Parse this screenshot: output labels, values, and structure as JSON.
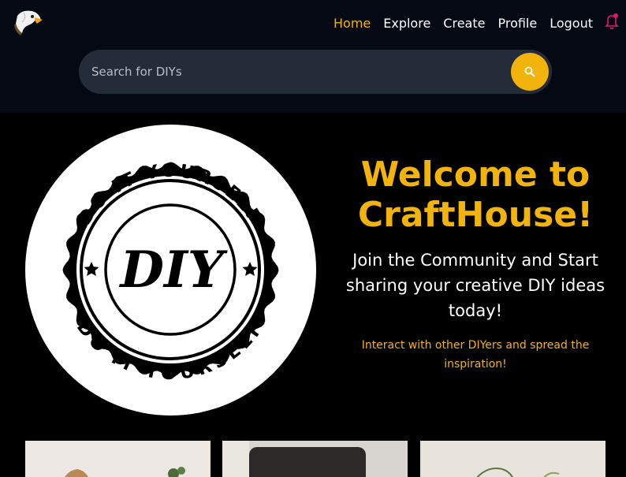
{
  "nav": {
    "items": [
      {
        "label": "Home",
        "active": true
      },
      {
        "label": "Explore"
      },
      {
        "label": "Create"
      },
      {
        "label": "Profile"
      },
      {
        "label": "Logout"
      }
    ],
    "logo_icon": "eagle-logo-icon",
    "bell_icon": "bell-icon",
    "accent": "#f2b40c",
    "notification_color": "#e0186e"
  },
  "search": {
    "placeholder": "Search for DIYs",
    "button_icon": "search-icon"
  },
  "hero": {
    "emblem": {
      "arc_top": "DO IT YOURSELF",
      "arc_bottom": "DO IT YOURSELF",
      "center": "DIY"
    },
    "title": "Welcome to CraftHouse!",
    "subtitle": "Join the Community and Start sharing your creative DIY ideas today!",
    "note": "Interact with other DIYers and spread the inspiration!"
  }
}
